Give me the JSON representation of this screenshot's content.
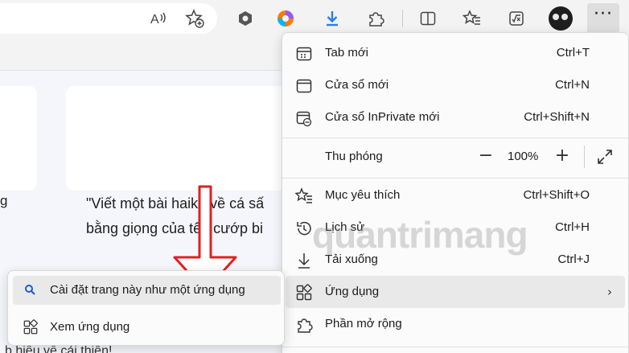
{
  "toolbar": {
    "icons": [
      "read-aloud-icon",
      "add-favorite-icon",
      "copilot-hexagon-icon",
      "edge-colorful-icon",
      "download-icon",
      "extensions-icon",
      "split-screen-icon",
      "favorites-icon",
      "math-solver-icon",
      "profile-avatar",
      "more-menu-icon"
    ],
    "accent": "#2b7de9"
  },
  "page": {
    "left_fragment": "g",
    "prompt_line1": "\"Viết một bài haiku về cá sấ",
    "prompt_line2": "bằng giọng của tên cướp bi",
    "bottom_fragment": "b hiểu về cải thiện!"
  },
  "menu": {
    "items": [
      {
        "label": "Tab mới",
        "shortcut": "Ctrl+T",
        "icon": "new-tab-icon"
      },
      {
        "label": "Cửa sổ mới",
        "shortcut": "Ctrl+N",
        "icon": "new-window-icon"
      },
      {
        "label": "Cửa sổ InPrivate mới",
        "shortcut": "Ctrl+Shift+N",
        "icon": "inprivate-window-icon"
      },
      {
        "label": "Thu phóng",
        "icon": "zoom-icon"
      },
      {
        "label": "Mục yêu thích",
        "shortcut": "Ctrl+Shift+O",
        "icon": "favorites-icon"
      },
      {
        "label": "Lịch sử",
        "shortcut": "Ctrl+H",
        "icon": "history-icon"
      },
      {
        "label": "Tải xuống",
        "shortcut": "Ctrl+J",
        "icon": "download-icon"
      },
      {
        "label": "Ứng dụng",
        "icon": "apps-icon",
        "chevron": "›"
      },
      {
        "label": "Phần mở rộng",
        "icon": "extensions-icon"
      }
    ],
    "zoom": {
      "minus": "−",
      "value": "100%",
      "plus": "+"
    }
  },
  "submenu": {
    "items": [
      {
        "label": "Cài đặt trang này như một ứng dụng",
        "icon": "search-icon"
      },
      {
        "label": "Xem ứng dụng",
        "icon": "apps-icon"
      }
    ]
  },
  "watermark": "quantrimang",
  "colors": {
    "highlight": "#e9e9e9",
    "arrow": "#e02020",
    "watermark": "#787878"
  }
}
